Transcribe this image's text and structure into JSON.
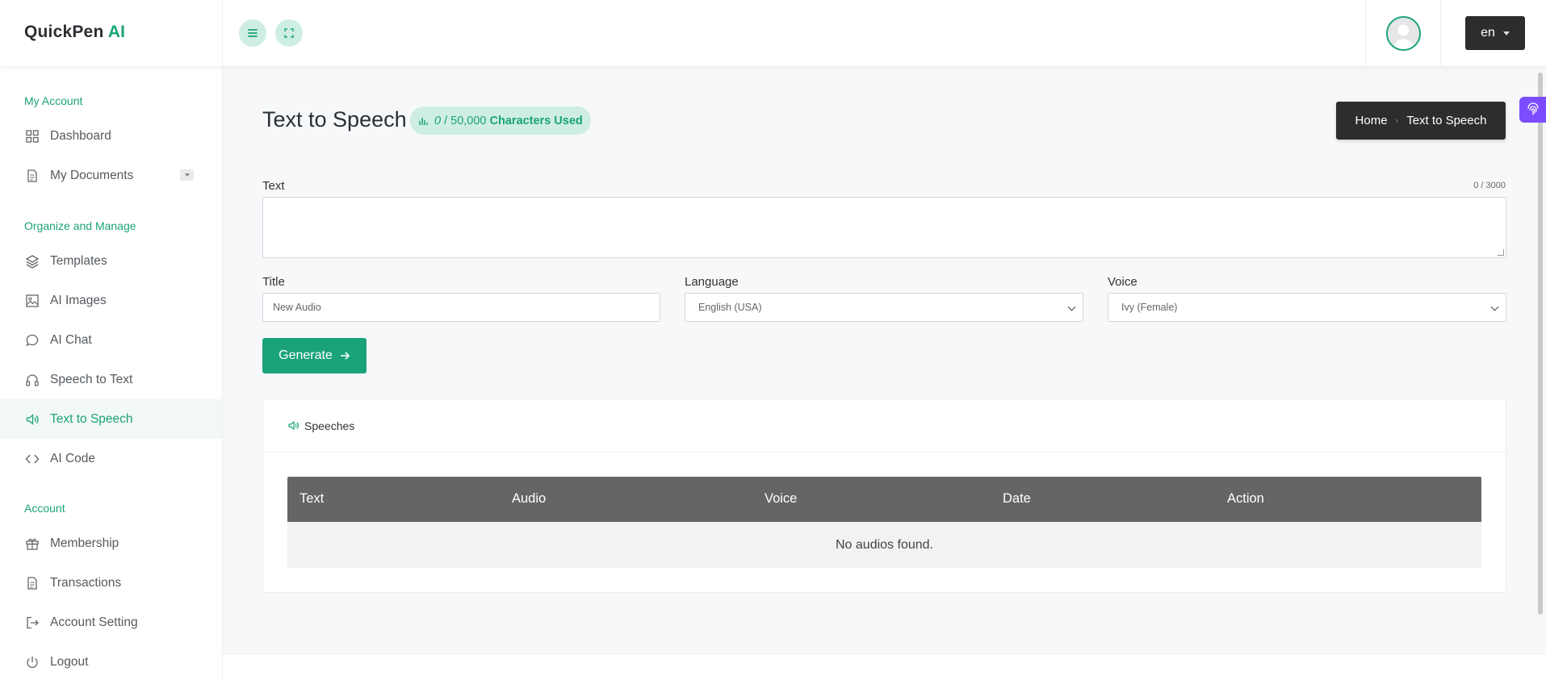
{
  "brand": {
    "name": "QuickPen",
    "ai": " AI"
  },
  "topbar": {
    "language": "en"
  },
  "sidebar": {
    "sections": [
      {
        "title": "My Account"
      },
      {
        "title": "Organize and Manage"
      },
      {
        "title": "Account"
      }
    ],
    "items": [
      {
        "label": "Dashboard",
        "icon": "grid-icon"
      },
      {
        "label": "My Documents",
        "icon": "document-icon"
      },
      {
        "label": "Templates",
        "icon": "layers-icon"
      },
      {
        "label": "AI Images",
        "icon": "image-icon"
      },
      {
        "label": "AI Chat",
        "icon": "chat-icon"
      },
      {
        "label": "Speech to Text",
        "icon": "headphones-icon"
      },
      {
        "label": "Text to Speech",
        "icon": "speaker-icon"
      },
      {
        "label": "AI Code",
        "icon": "code-icon"
      },
      {
        "label": "Membership",
        "icon": "gift-icon"
      },
      {
        "label": "Transactions",
        "icon": "receipt-icon"
      },
      {
        "label": "Account Setting",
        "icon": "signout-icon"
      },
      {
        "label": "Logout",
        "icon": "power-icon"
      }
    ]
  },
  "main": {
    "title": "Text to Speech",
    "usage": {
      "used": "0",
      "total": "/ 50,000",
      "label": "Characters Used"
    },
    "breadcrumb": {
      "home": "Home",
      "current": "Text to Speech"
    },
    "text_label": "Text",
    "counter": "0 / 3000",
    "title_label": "Title",
    "title_placeholder": "New Audio",
    "language_label": "Language",
    "language_value": "English (USA)",
    "voice_label": "Voice",
    "voice_value": "Ivy (Female)",
    "generate_label": "Generate",
    "speeches": {
      "header": "Speeches",
      "columns": [
        "Text",
        "Audio",
        "Voice",
        "Date",
        "Action"
      ],
      "empty": "No audios found."
    }
  },
  "colors": {
    "accent": "#1aa37a",
    "dark": "#2c2d2f",
    "badge_bg": "#cfeee2"
  }
}
